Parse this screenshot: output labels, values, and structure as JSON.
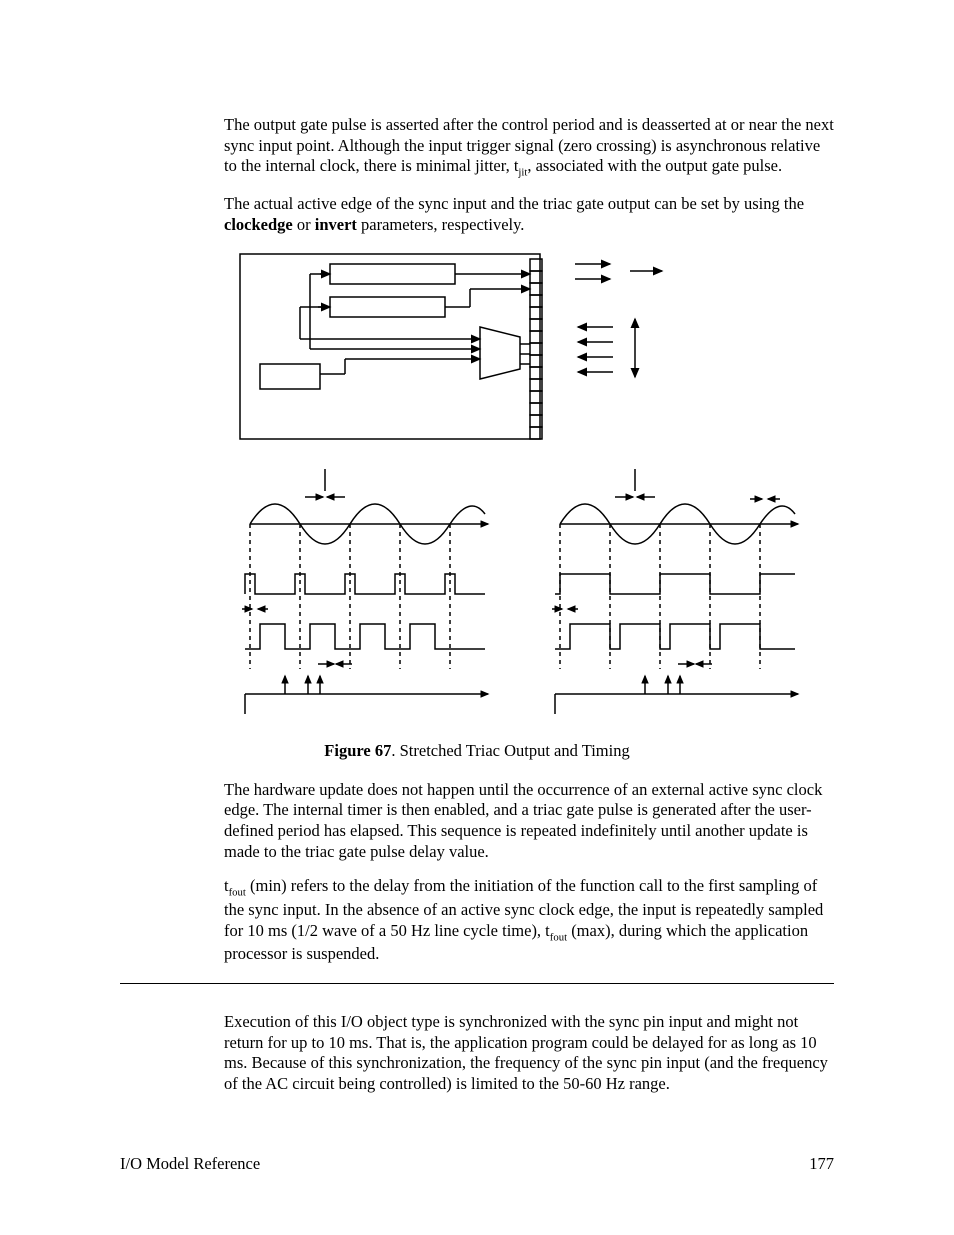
{
  "paragraphs": {
    "p1_a": "The output gate pulse is asserted after the control period and is deasserted at or near the next sync input point.  Although the input trigger signal (zero crossing) is asynchronous relative to the internal clock, there is minimal jitter, t",
    "p1_sub": "jit",
    "p1_b": ", associated with the output gate pulse.",
    "p2_a": "The actual active edge of the sync input and the triac gate output can be set by using the ",
    "p2_bold1": "clockedge",
    "p2_mid": " or ",
    "p2_bold2": "invert",
    "p2_b": " parameters, respectively.",
    "caption_bold": "Figure 67",
    "caption_rest": ". Stretched Triac Output and Timing",
    "p3": "The hardware update does not happen until the occurrence of an external active sync clock edge.  The internal timer is then enabled, and a triac gate pulse is generated after the user-defined period has elapsed.  This sequence is repeated indefinitely until another update is made to the triac gate pulse delay value.",
    "p4_a": "t",
    "p4_sub1": "fout",
    "p4_b": " (min) refers to the delay from the initiation of the function call to the first sampling of the sync input.  In the absence of an active sync clock edge, the input is repeatedly sampled for 10 ms (1/2 wave of a 50 Hz line cycle time), t",
    "p4_sub2": "fout",
    "p4_c": " (max), during which the application processor is suspended.",
    "p5": "Execution of this I/O object type is synchronized with the sync pin input and might not return for up to 10 ms.  That is, the application program could be delayed for as long as 10 ms.  Because of this synchronization, the frequency of the sync pin input (and the frequency of the AC circuit being controlled) is limited to the 50-60 Hz range."
  },
  "footer": {
    "left": "I/O Model Reference",
    "right": "177"
  }
}
